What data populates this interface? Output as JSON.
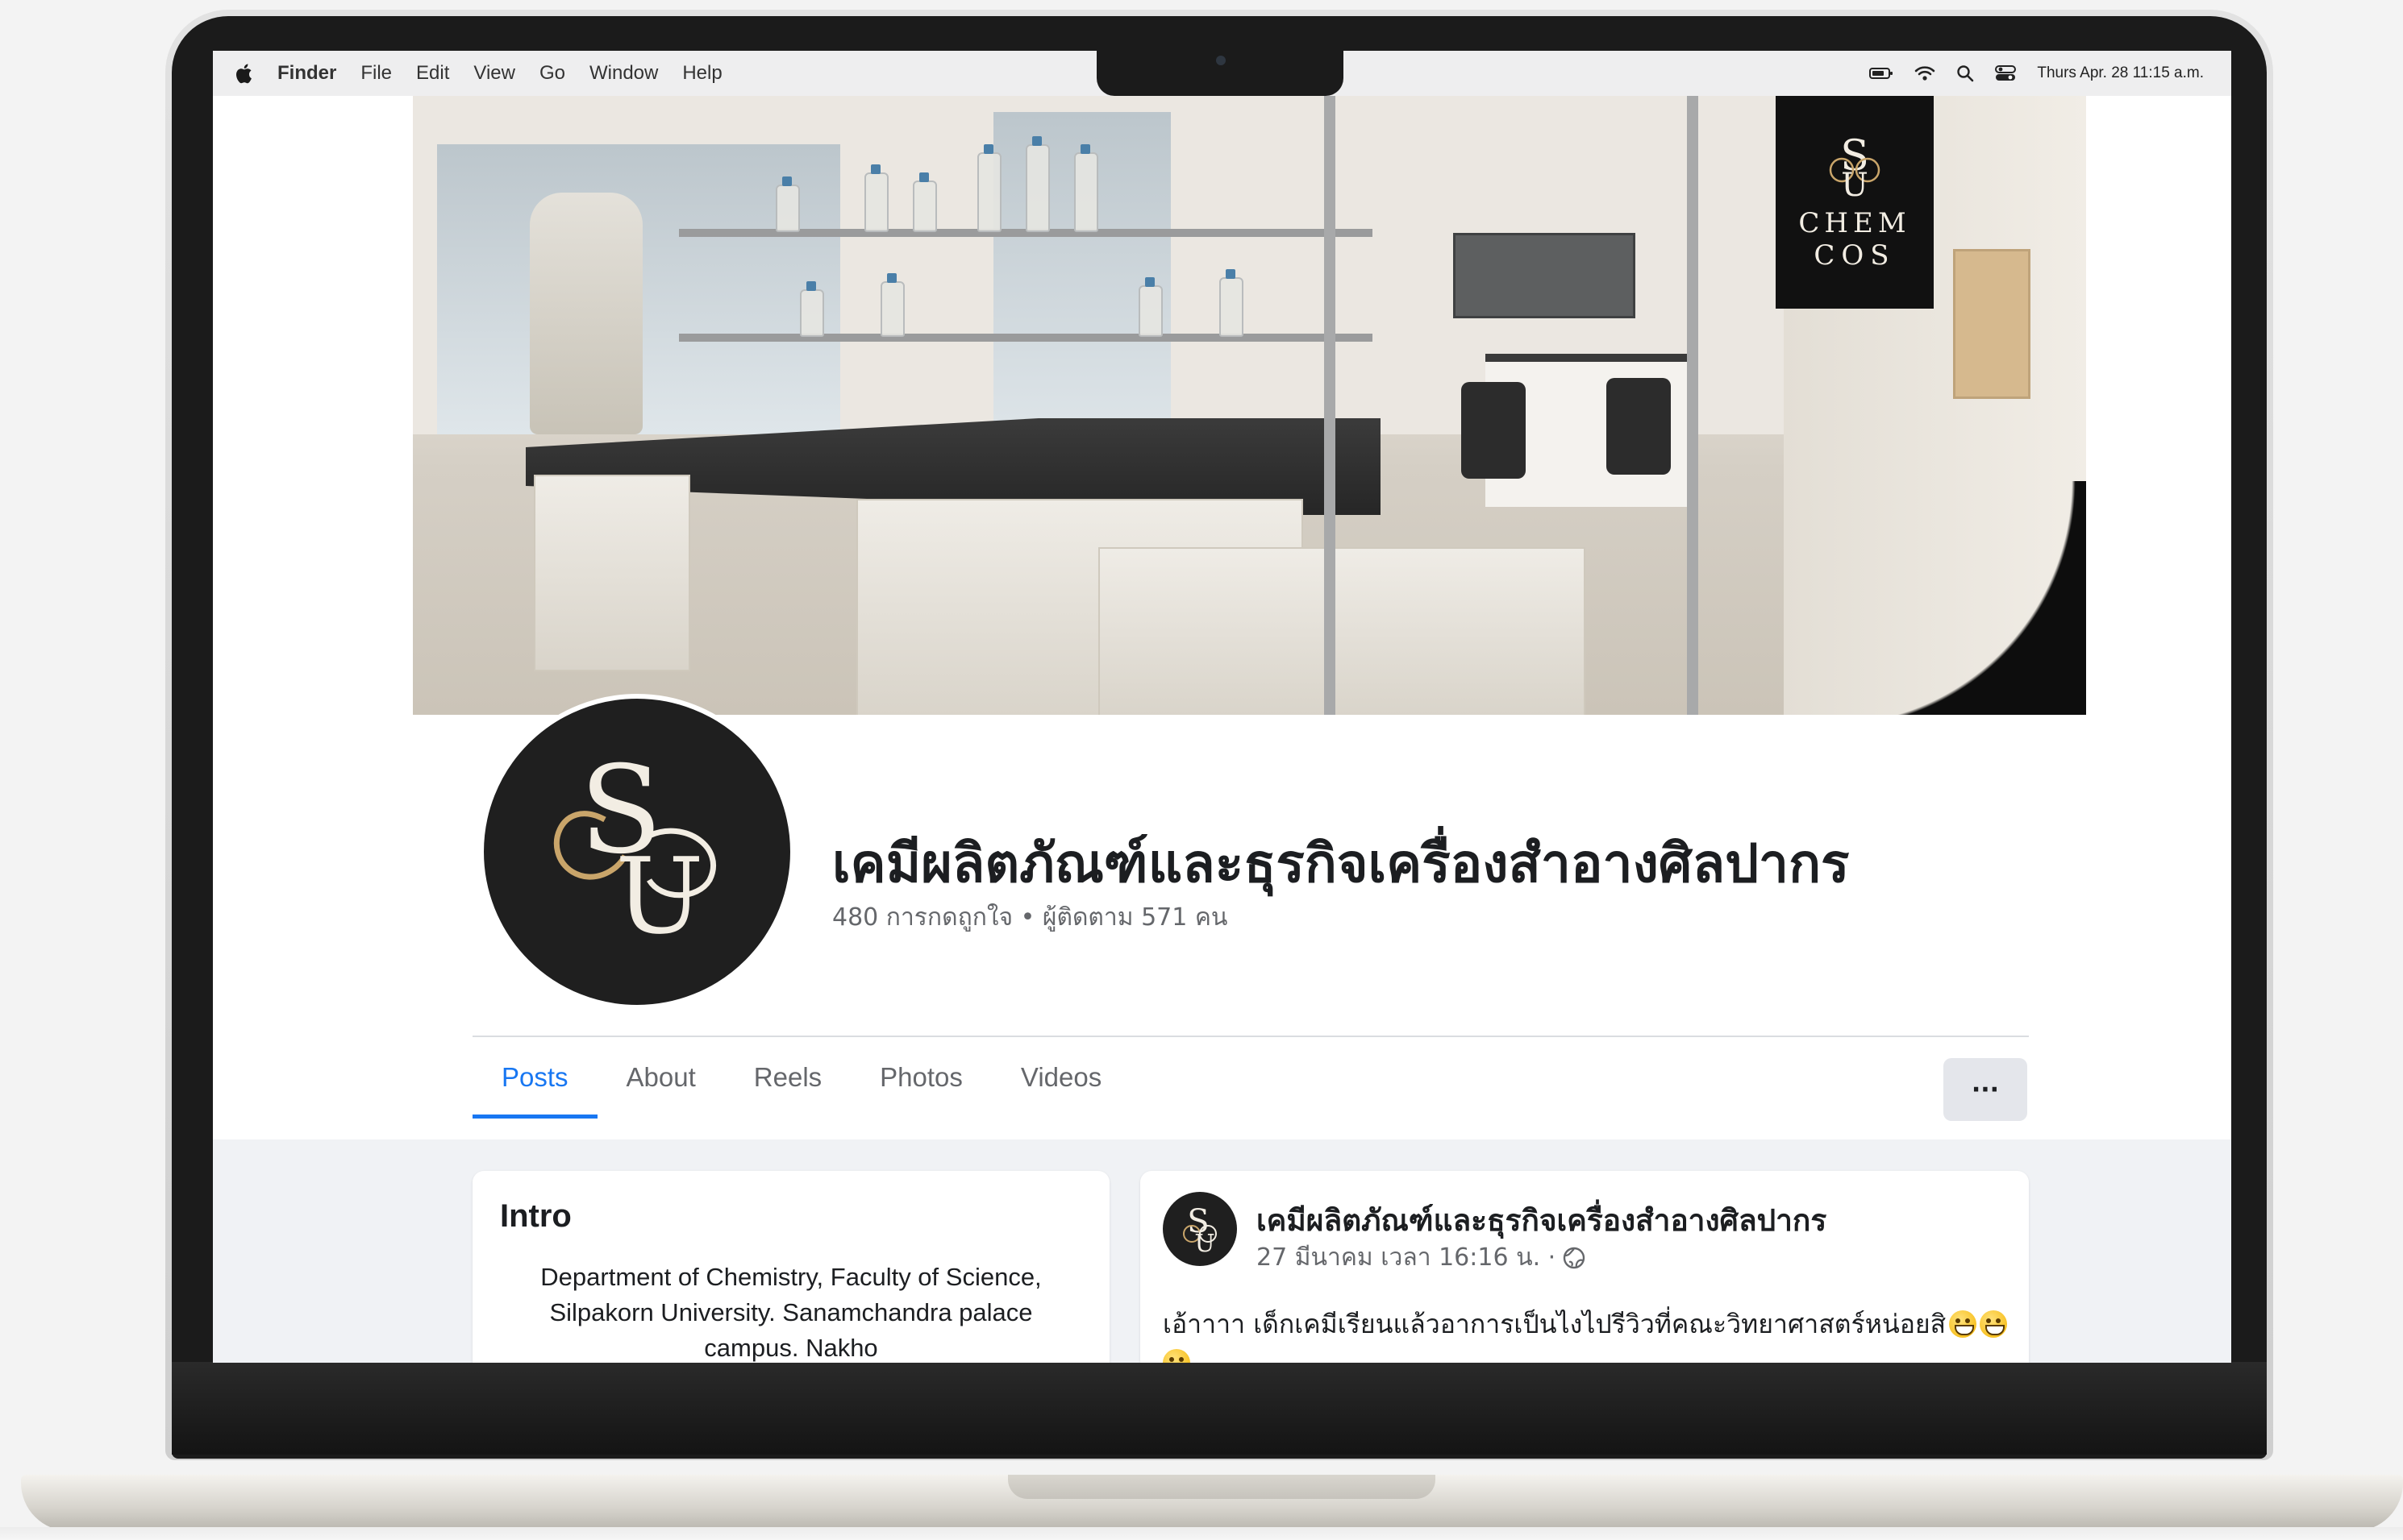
{
  "menubar": {
    "app_name": "Finder",
    "items": [
      "File",
      "Edit",
      "View",
      "Go",
      "Window",
      "Help"
    ],
    "clock": "Thurs Apr. 28 11:15 a.m."
  },
  "cover": {
    "brand_line1": "CHEM",
    "brand_line2": "COS"
  },
  "page": {
    "name": "เคมีผลิตภัณฑ์และธุรกิจเครื่องสำอางศิลปากร",
    "stats": "480 การกดถูกใจ • ผู้ติดตาม 571 คน"
  },
  "tabs": [
    {
      "label": "Posts",
      "active": true
    },
    {
      "label": "About",
      "active": false
    },
    {
      "label": "Reels",
      "active": false
    },
    {
      "label": "Photos",
      "active": false
    },
    {
      "label": "Videos",
      "active": false
    }
  ],
  "more_button": "···",
  "intro": {
    "title": "Intro",
    "description": "Department of Chemistry, Faculty of Science, Silpakorn University. Sanamchandra palace campus. Nakho"
  },
  "post": {
    "author": "เคมีผลิตภัณฑ์และธุรกิจเครื่องสำอางศิลปากร",
    "timestamp": "27 มีนาคม เวลา 16:16 น. ·",
    "text": "เอ้าาาา เด็กเคมีเรียนแล้วอาการเป็นไงไปรีวิวที่คณะวิทยาศาสตร์หน่อยสิ"
  },
  "colors": {
    "accent": "#1877f2",
    "gold": "#c9a56a",
    "feed_bg": "#f0f2f5"
  }
}
